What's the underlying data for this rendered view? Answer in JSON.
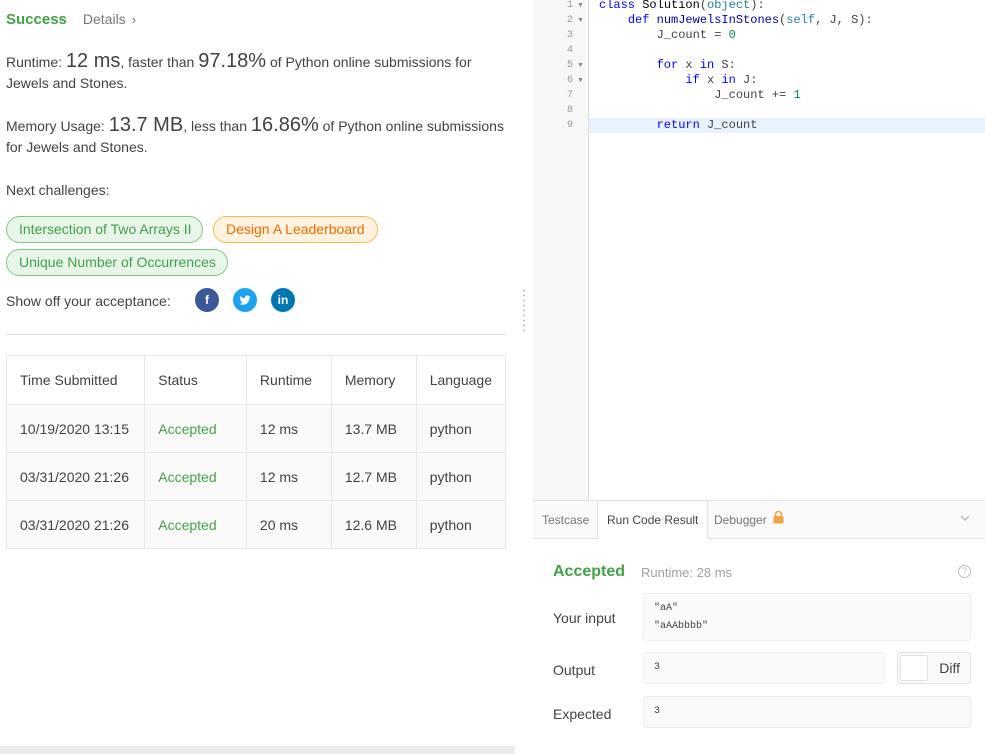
{
  "header": {
    "status": "Success",
    "details_label": "Details",
    "details_chevron": "›"
  },
  "runtime_stat": {
    "label": "Runtime:",
    "value": "12 ms",
    "mid": ", faster than",
    "percent": "97.18%",
    "tail": "of Python online submissions for Jewels and Stones."
  },
  "memory_stat": {
    "label": "Memory Usage:",
    "value": "13.7 MB",
    "mid": ", less than",
    "percent": "16.86%",
    "tail": "of Python online submissions for Jewels and Stones."
  },
  "next_challenges": {
    "label": "Next challenges:",
    "items": [
      "Intersection of Two Arrays II",
      "Design A Leaderboard",
      "Unique Number of Occurrences"
    ]
  },
  "share": {
    "label": "Show off your acceptance:",
    "icons": [
      "facebook-icon",
      "twitter-icon",
      "linkedin-icon"
    ],
    "fb": "f",
    "li": "in"
  },
  "submissions": {
    "headers": [
      "Time Submitted",
      "Status",
      "Runtime",
      "Memory",
      "Language"
    ],
    "rows": [
      [
        "10/19/2020 13:15",
        "Accepted",
        "12 ms",
        "13.7 MB",
        "python"
      ],
      [
        "03/31/2020 21:26",
        "Accepted",
        "12 ms",
        "12.7 MB",
        "python"
      ],
      [
        "03/31/2020 21:26",
        "Accepted",
        "20 ms",
        "12.6 MB",
        "python"
      ]
    ]
  },
  "editor": {
    "line_numbers": [
      "1",
      "2",
      "3",
      "4",
      "5",
      "6",
      "7",
      "8",
      "9"
    ]
  },
  "console": {
    "tabs": [
      "Testcase",
      "Run Code Result",
      "Debugger"
    ],
    "status": "Accepted",
    "runtime": "Runtime: 28 ms",
    "input_label": "Your input",
    "input_line1": "\"aA\"",
    "input_line2": "\"aAAbbbb\"",
    "output_label": "Output",
    "output_value": "3",
    "expected_label": "Expected",
    "expected_value": "3",
    "diff_label": "Diff"
  },
  "colors": {
    "accent_green": "#43a047",
    "orange": "#ef6c00"
  }
}
